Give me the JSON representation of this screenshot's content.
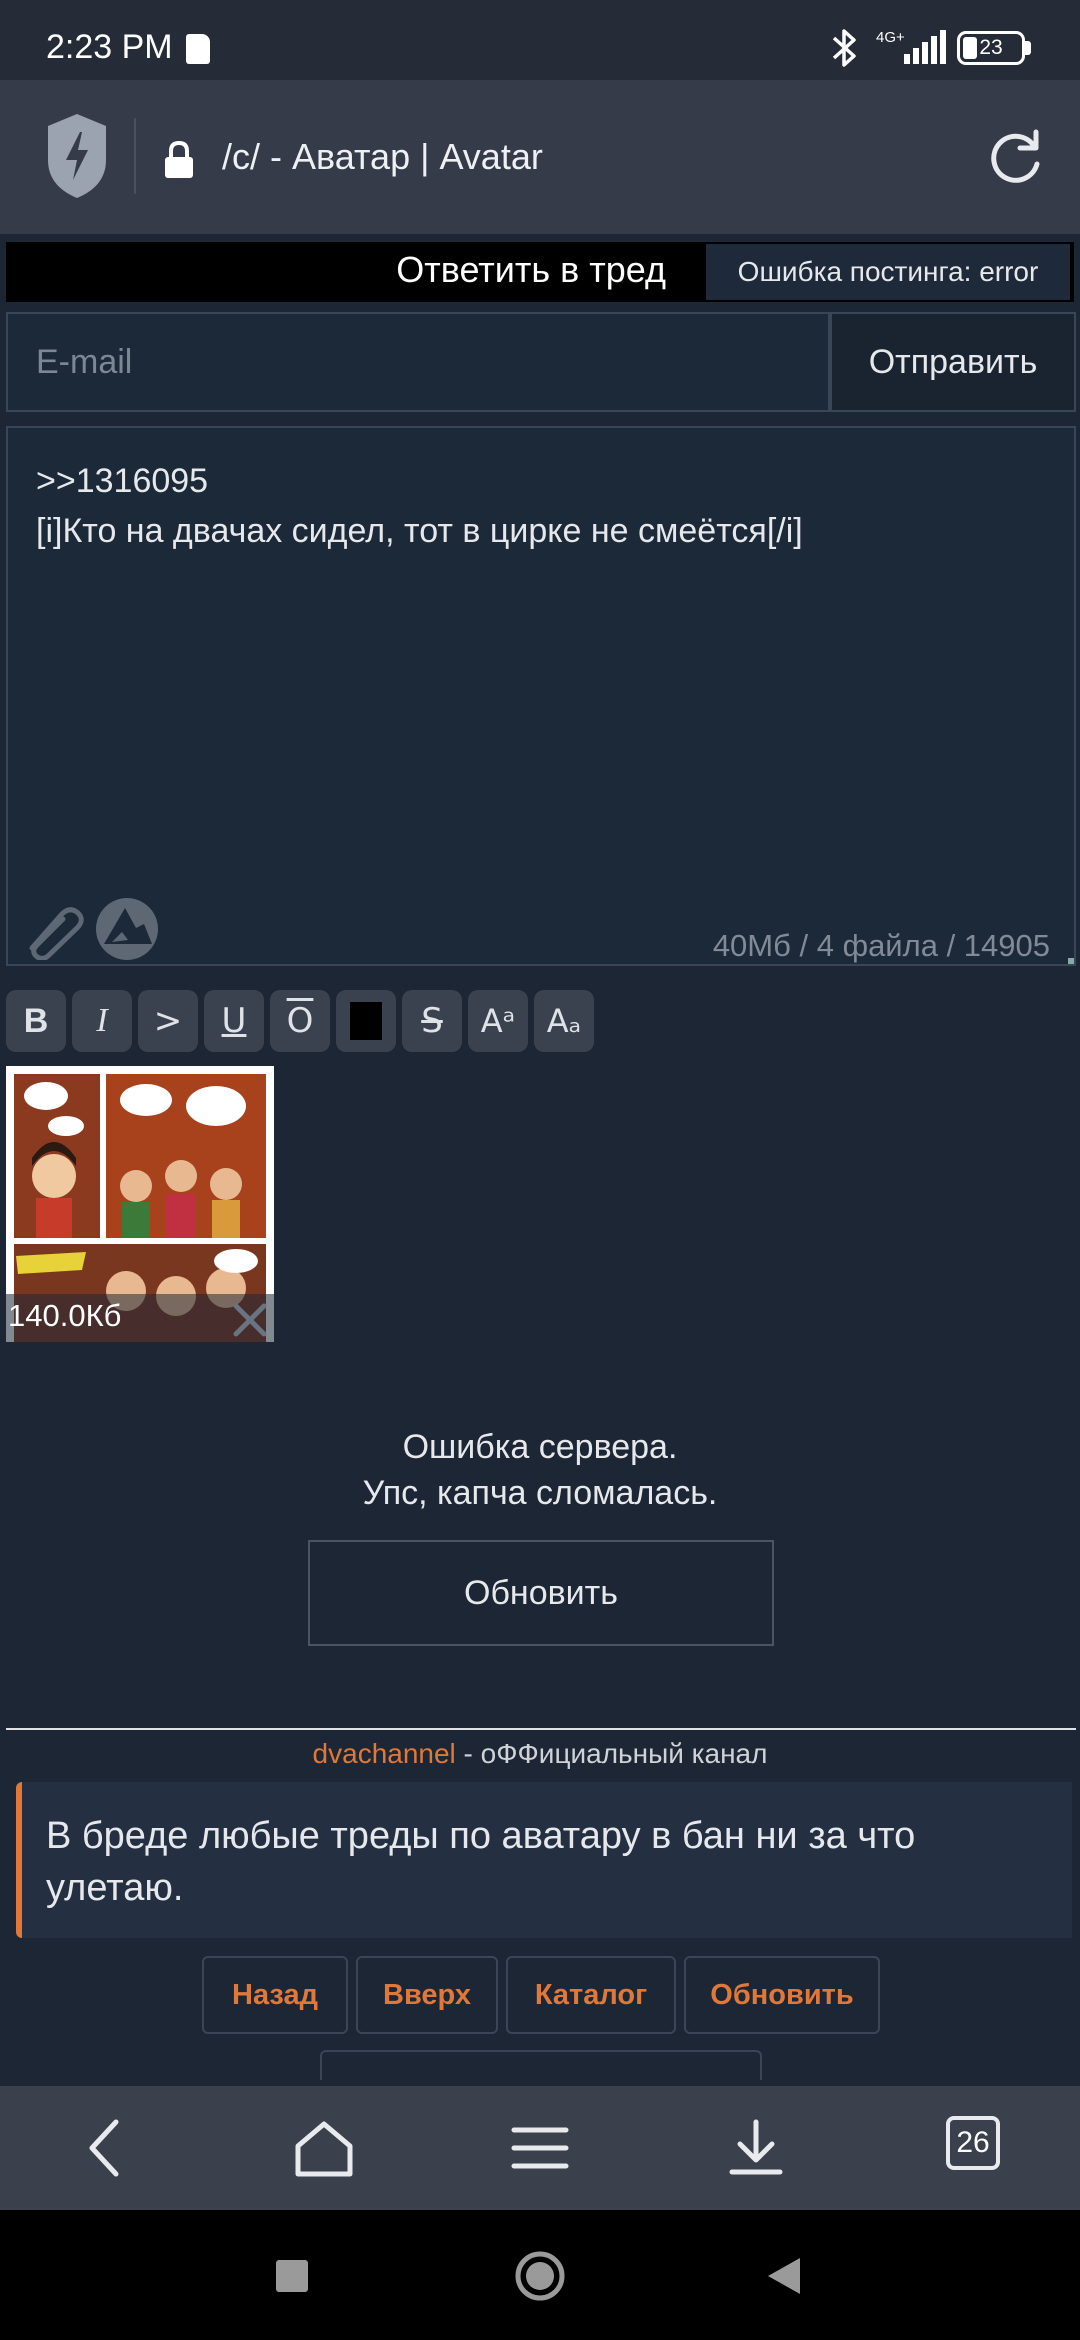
{
  "status_bar": {
    "time": "2:23 PM",
    "network": "4G+",
    "battery": "23"
  },
  "browser": {
    "url_text": "/c/ - Аватар | Avatar",
    "tabs_count": "26"
  },
  "reply_form": {
    "title": "Ответить в тред",
    "error": "Ошибка постинга: error",
    "email_placeholder": "E-mail",
    "send_label": "Отправить",
    "message": ">>1316095\n[i]Кто на двачах сидел, тот в цирке не смеётся[/i]",
    "limits": "40Мб / 4 файла / 14905"
  },
  "toolbar": {
    "bold": "B",
    "italic": "I",
    "quote": ">",
    "underline": "U",
    "overline": "O",
    "spoiler": "",
    "strike": "S",
    "sup": "Aᵃ",
    "sub": "Aₐ"
  },
  "attachment": {
    "size": "140.0Кб"
  },
  "captcha": {
    "error_line1": "Ошибка сервера.",
    "error_line2": "Упс, капча сломалась.",
    "refresh_label": "Обновить"
  },
  "channel": {
    "link": "dvachannel",
    "text": " - оФФициальный канал"
  },
  "banner_quote": "В бреде любые треды по аватару в бан ни за что улетаю.",
  "nav": {
    "back": "Назад",
    "up": "Вверх",
    "catalog": "Каталог",
    "refresh": "Обновить"
  },
  "colors": {
    "background": "#1c2634",
    "accent": "#e0783a",
    "panel": "#1c2938"
  }
}
